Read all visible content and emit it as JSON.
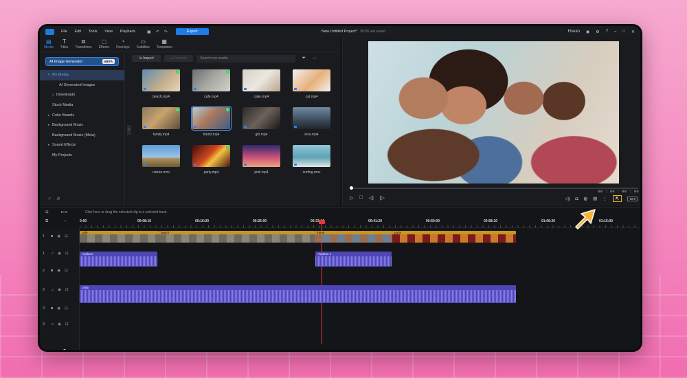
{
  "colors": {
    "accent": "#1e7be8",
    "highlight": "#f3b51b",
    "playhead": "#e23a3a",
    "video_clip": "#c8961f",
    "audio_clip": "#4e46b7"
  },
  "titlebar": {
    "menu": [
      "File",
      "Edit",
      "Tools",
      "View",
      "Playback"
    ],
    "export_label": "Export",
    "project_title": "New Untitled Project*",
    "saved_status": "09:56 last saved",
    "user": "Hsuan",
    "help": "?"
  },
  "tools": [
    {
      "label": "Media",
      "icon": "folder-icon"
    },
    {
      "label": "Titles",
      "icon": "title-icon"
    },
    {
      "label": "Transitions",
      "icon": "transition-icon"
    },
    {
      "label": "Effects",
      "icon": "effects-icon"
    },
    {
      "label": "Overlays",
      "icon": "overlay-icon"
    },
    {
      "label": "Subtitles",
      "icon": "subtitle-icon"
    },
    {
      "label": "Templates",
      "icon": "template-icon"
    }
  ],
  "sidebar": {
    "ai_generator": "AI Image Generator",
    "beta": "BETA",
    "items": [
      "My Media",
      "AI Generated Images",
      "Downloads",
      "Stock Media",
      "Color Boards",
      "Background Music",
      "Background Music (Meta)",
      "Sound Effects",
      "My Projects"
    ]
  },
  "media": {
    "import_label": "Import",
    "record_label": "Record",
    "search_placeholder": "Search my media",
    "items": [
      {
        "name": "beach.mp4",
        "bg": "linear-gradient(135deg,#5b8db0,#c9b08a 60%,#e4d6bd)",
        "checked": true,
        "selected": false
      },
      {
        "name": "cafe.mp4",
        "bg": "linear-gradient(135deg,#6a6e72,#a8a9a3 50%,#d3d0c8)",
        "checked": true,
        "selected": false
      },
      {
        "name": "cake.mp4",
        "bg": "linear-gradient(135deg,#d6d0c6,#ece8e0 50%,#b7a58f)",
        "checked": false,
        "selected": false
      },
      {
        "name": "cat.mp4",
        "bg": "linear-gradient(135deg,#f2f0ee,#e6b07b 55%,#f4f1ec)",
        "checked": false,
        "selected": false
      },
      {
        "name": "family.mp4",
        "bg": "linear-gradient(135deg,#8a7a5e,#c9a36e 45%,#5b4d3a)",
        "checked": true,
        "selected": false
      },
      {
        "name": "friend.mp4",
        "bg": "linear-gradient(135deg,#b9cdd3,#a9785c 45%,#3f5e86)",
        "checked": true,
        "selected": true
      },
      {
        "name": "girl.mp4",
        "bg": "linear-gradient(135deg,#2a2a2a,#6d6259 50%,#181818)",
        "checked": false,
        "selected": false
      },
      {
        "name": "love.mp4",
        "bg": "linear-gradient(180deg,#6e8aa3,#3b4a58 60%,#1f252c)",
        "checked": false,
        "selected": false
      },
      {
        "name": "nature.mov",
        "bg": "linear-gradient(180deg,#5e9bd6 0%,#9cc4e6 55%,#a98f57 62%,#6f5a36)",
        "checked": false,
        "selected": false
      },
      {
        "name": "party.mp4",
        "bg": "linear-gradient(135deg,#3b0d0d,#d14a1f 45%,#f2c341 60%,#4a1010)",
        "checked": true,
        "selected": false
      },
      {
        "name": "pink.mp4",
        "bg": "linear-gradient(180deg,#2e2a6e,#c9507a 55%,#f0a27a)",
        "checked": false,
        "selected": false
      },
      {
        "name": "surfing.mov",
        "bg": "linear-gradient(180deg,#8fc6d9,#5ea2b5 55%,#dfe7e6)",
        "checked": false,
        "selected": false
      }
    ]
  },
  "preview": {
    "timecode": "00 : 00 : 00 : 00",
    "ratio": "16:9"
  },
  "timeline": {
    "hint": "Click here or drag the selected clip to a selected track.",
    "ticks": [
      "0:00",
      "00:08:10",
      "00:16:20",
      "00:25:00",
      "00:33:10",
      "00:41:20",
      "00:50:00",
      "00:58:10",
      "01:06:20",
      "01:15:00"
    ],
    "tracks": [
      {
        "num": "1",
        "type": "video"
      },
      {
        "num": "1",
        "type": "audio"
      },
      {
        "num": "2",
        "type": "video"
      },
      {
        "num": "2",
        "type": "audio"
      },
      {
        "num": "3",
        "type": "video"
      },
      {
        "num": "3",
        "type": "audio"
      }
    ],
    "clips": {
      "v1": [
        {
          "label": "cafe"
        },
        {
          "label": "beach"
        },
        {
          "label": "friend"
        },
        {
          "label": "party"
        }
      ],
      "a1": [
        {
          "label": "Airplane"
        },
        {
          "label": "Airplane 1"
        }
      ],
      "a2": [
        {
          "label": "1985"
        }
      ]
    }
  }
}
